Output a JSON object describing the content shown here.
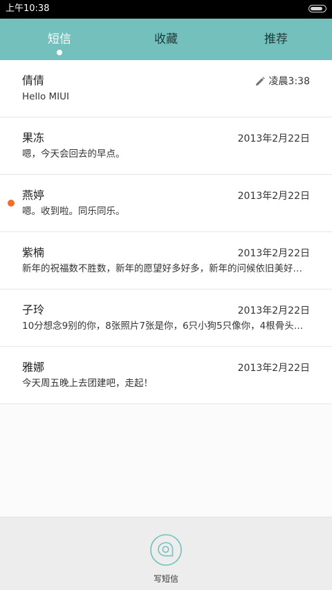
{
  "status_bar": {
    "time": "上午10:38",
    "battery_level": 0.9
  },
  "tabs": [
    {
      "label": "短信",
      "active": true
    },
    {
      "label": "收藏",
      "active": false
    },
    {
      "label": "推荐",
      "active": false
    }
  ],
  "conversations": [
    {
      "name": "倩倩",
      "preview": "Hello MIUI",
      "date": "凌晨3:38",
      "draft": true,
      "unread": false
    },
    {
      "name": "果冻",
      "preview": "嗯，今天会回去的早点。",
      "date": "2013年2月22日",
      "draft": false,
      "unread": false
    },
    {
      "name": "燕婷",
      "preview": "嗯。收到啦。同乐同乐。",
      "date": "2013年2月22日",
      "draft": false,
      "unread": true
    },
    {
      "name": "紫楠",
      "preview": "新年的祝福数不胜数，新年的愿望好多好多，新年的问候依旧美好…",
      "date": "2013年2月22日",
      "draft": false,
      "unread": false
    },
    {
      "name": "子玲",
      "preview": "10分想念9别的你，8张照片7张是你，6只小狗5只像你，4根骨头…",
      "date": "2013年2月22日",
      "draft": false,
      "unread": false
    },
    {
      "name": "雅娜",
      "preview": "今天周五晚上去团建吧，走起！",
      "date": "2013年2月22日",
      "draft": false,
      "unread": false
    }
  ],
  "compose": {
    "label": "写短信",
    "icon": "compose-message-icon"
  },
  "colors": {
    "accent": "#73c0bd",
    "unread_dot": "#f36c2b"
  }
}
